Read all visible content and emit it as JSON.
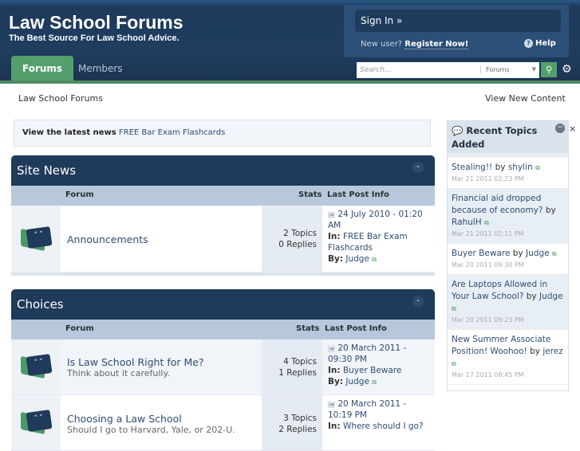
{
  "header": {
    "title": "Law School Forums",
    "tagline": "The Best Source For Law School Advice.",
    "sign_in": "Sign In »",
    "new_user": "New user?",
    "register": "Register Now!",
    "help": "Help"
  },
  "nav": {
    "tabs": [
      {
        "label": "Forums"
      },
      {
        "label": "Members"
      }
    ],
    "search_placeholder": "Search...",
    "search_scope": "Forums"
  },
  "breadcrumb": "Law School Forums",
  "view_new": "View New Content",
  "news": {
    "label": "View the latest news",
    "link": "FREE Bar Exam Flashcards"
  },
  "columns": {
    "forum": "Forum",
    "stats": "Stats",
    "last": "Last Post Info",
    "in": "In:",
    "by": "By:"
  },
  "categories": [
    {
      "title": "Site News",
      "forums": [
        {
          "name": "Announcements",
          "desc": "",
          "topics": "2 Topics",
          "replies": "0 Replies",
          "date": "24 July 2010 - 01:20 AM",
          "in": "FREE Bar Exam Flashcards",
          "by": "Judge"
        }
      ]
    },
    {
      "title": "Choices",
      "forums": [
        {
          "name": "Is Law School Right for Me?",
          "desc": "Think about it carefully.",
          "topics": "4 Topics",
          "replies": "1 Replies",
          "date": "20 March 2011 - 09:30 PM",
          "in": "Buyer Beware",
          "by": "Judge"
        },
        {
          "name": "Choosing a Law School",
          "desc": "Should I go to Harvard, Yale, or 202-U.",
          "topics": "3 Topics",
          "replies": "2 Replies",
          "date": "20 March 2011 - 10:19 PM",
          "in": "Where should I go?",
          "by": ""
        }
      ]
    }
  ],
  "sidebar": {
    "title": "Recent Topics Added",
    "items": [
      {
        "title": "Stealing!!",
        "by": "by",
        "user": "shylin",
        "date": "Mar 21 2011 02:23 PM"
      },
      {
        "title": "Financial aid dropped because of economy?",
        "by": "by",
        "user": "RahulH",
        "date": "Mar 21 2011 02:11 PM"
      },
      {
        "title": "Buyer Beware",
        "by": "by",
        "user": "Judge",
        "date": "Mar 20 2011 09:30 PM"
      },
      {
        "title": "Are Laptops Allowed in Your Law School?",
        "by": "by",
        "user": "Judge",
        "date": "Mar 20 2011 09:23 PM"
      },
      {
        "title": "New Summer Associate Position! Woohoo!",
        "by": "by",
        "user": "jerez",
        "date": "Mar 17 2011 08:45 PM"
      }
    ]
  }
}
